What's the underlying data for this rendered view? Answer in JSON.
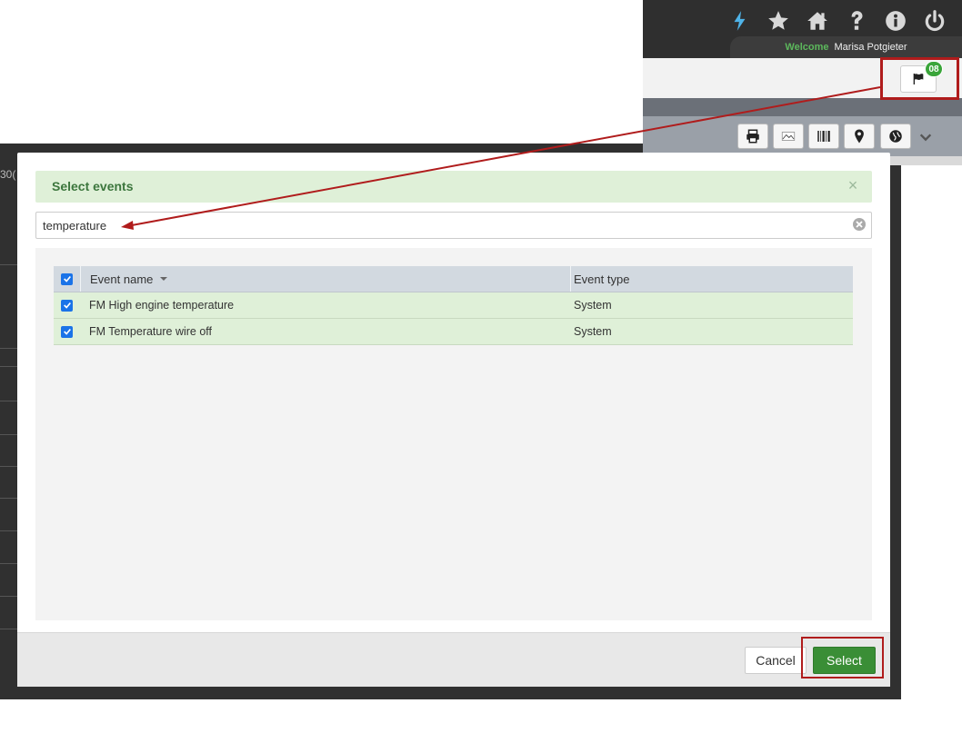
{
  "header": {
    "welcome_label": "Welcome",
    "user_name": "Marisa Potgieter",
    "icons": [
      "lightning-icon",
      "star-icon",
      "home-icon",
      "help-icon",
      "info-icon",
      "power-icon"
    ],
    "notification_count": "08",
    "toolbar_icons": [
      "print-icon",
      "image-export-icon",
      "barcode-icon",
      "map-pin-icon",
      "globe-icon",
      "chevron-down-icon"
    ]
  },
  "background": {
    "partial_text": "30("
  },
  "modal": {
    "title": "Select events",
    "close_symbol": "×",
    "search_value": "temperature",
    "columns": {
      "event_name": "Event name",
      "event_type": "Event type"
    },
    "rows": [
      {
        "event_name": "FM High engine temperature",
        "event_type": "System",
        "checked": true
      },
      {
        "event_name": "FM Temperature wire off",
        "event_type": "System",
        "checked": true
      }
    ],
    "cancel_label": "Cancel",
    "select_label": "Select"
  },
  "colors": {
    "accent_green": "#3a8e36",
    "header_green_bg": "#dff0d8",
    "annotation_red": "#b01c1c",
    "checkbox_blue": "#1a73e8"
  }
}
